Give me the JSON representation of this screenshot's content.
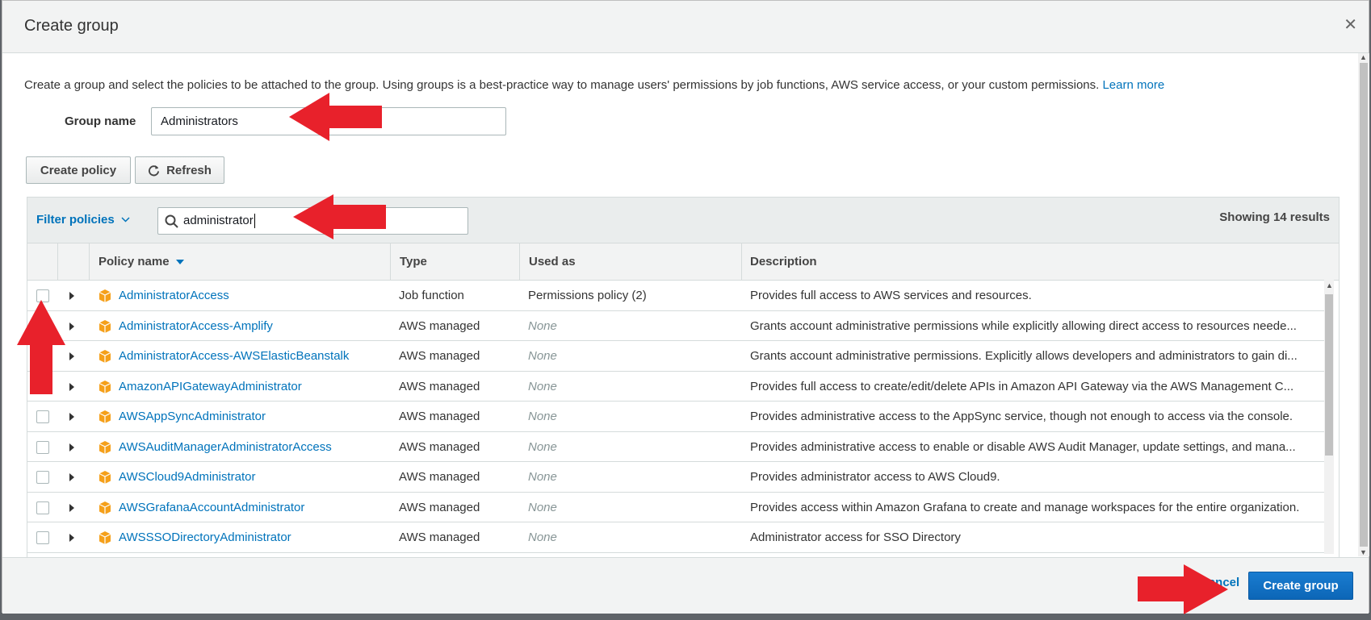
{
  "dialog": {
    "title": "Create group",
    "intro": "Create a group and select the policies to be attached to the group. Using groups is a best-practice way to manage users' permissions by job functions, AWS service access, or your custom permissions.",
    "learn_more": "Learn more"
  },
  "group_name": {
    "label": "Group name",
    "value": "Administrators"
  },
  "toolbar": {
    "create_policy": "Create policy",
    "refresh": "Refresh"
  },
  "filter": {
    "label": "Filter policies",
    "search_value": "administrator",
    "results": "Showing 14 results"
  },
  "table": {
    "headers": {
      "name": "Policy name",
      "type": "Type",
      "used_as": "Used as",
      "description": "Description"
    },
    "rows": [
      {
        "name": "AdministratorAccess",
        "type": "Job function",
        "used_as": "Permissions policy (2)",
        "description": "Provides full access to AWS services and resources."
      },
      {
        "name": "AdministratorAccess-Amplify",
        "type": "AWS managed",
        "used_as": "None",
        "description": "Grants account administrative permissions while explicitly allowing direct access to resources neede..."
      },
      {
        "name": "AdministratorAccess-AWSElasticBeanstalk",
        "type": "AWS managed",
        "used_as": "None",
        "description": "Grants account administrative permissions. Explicitly allows developers and administrators to gain di..."
      },
      {
        "name": "AmazonAPIGatewayAdministrator",
        "type": "AWS managed",
        "used_as": "None",
        "description": "Provides full access to create/edit/delete APIs in Amazon API Gateway via the AWS Management C..."
      },
      {
        "name": "AWSAppSyncAdministrator",
        "type": "AWS managed",
        "used_as": "None",
        "description": "Provides administrative access to the AppSync service, though not enough to access via the console."
      },
      {
        "name": "AWSAuditManagerAdministratorAccess",
        "type": "AWS managed",
        "used_as": "None",
        "description": "Provides administrative access to enable or disable AWS Audit Manager, update settings, and mana..."
      },
      {
        "name": "AWSCloud9Administrator",
        "type": "AWS managed",
        "used_as": "None",
        "description": "Provides administrator access to AWS Cloud9."
      },
      {
        "name": "AWSGrafanaAccountAdministrator",
        "type": "AWS managed",
        "used_as": "None",
        "description": "Provides access within Amazon Grafana to create and manage workspaces for the entire organization."
      },
      {
        "name": "AWSSSODirectoryAdministrator",
        "type": "AWS managed",
        "used_as": "None",
        "description": "Administrator access for SSO Directory"
      }
    ]
  },
  "footer": {
    "cancel": "Cancel",
    "create_group": "Create group"
  },
  "colors": {
    "link": "#0073bb",
    "primary_button": "#0c66b7",
    "annotation_arrow": "#e8212b",
    "policy_icon": "#f5a01a"
  }
}
